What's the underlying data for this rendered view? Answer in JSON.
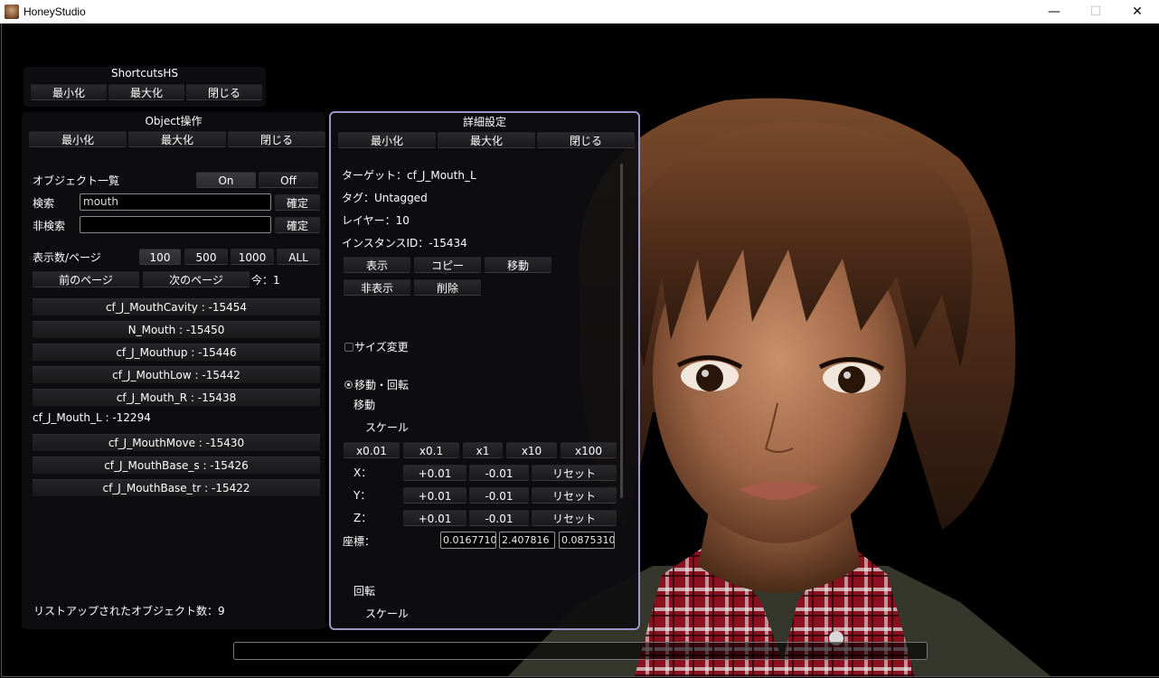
{
  "window": {
    "title": "HoneyStudio",
    "controls": {
      "minimize": "—",
      "maximize": "☐",
      "close": "✕"
    }
  },
  "shortcuts_panel": {
    "title": "ShortcutsHS",
    "buttons": [
      "最小化",
      "最大化",
      "閉じる"
    ]
  },
  "object_panel": {
    "title": "Object操作",
    "buttons": [
      "最小化",
      "最大化",
      "閉じる"
    ],
    "object_list_label": "オブジェクト一覧",
    "on_label": "On",
    "off_label": "Off",
    "search_label": "検索",
    "search_value": "mouth",
    "confirm_label": "確定",
    "exclude_label": "非検索",
    "exclude_value": "",
    "per_page_label": "表示数/ページ",
    "per_page_options": [
      "100",
      "500",
      "1000",
      "ALL"
    ],
    "prev_page": "前のページ",
    "next_page": "次のページ",
    "current_page": "今：1",
    "items": [
      "cf_J_MouthCavity : -15454",
      "N_Mouth : -15450",
      "cf_J_Mouthup : -15446",
      "cf_J_MouthLow : -15442",
      "cf_J_Mouth_R : -15438",
      "cf_J_Mouth_L : -12294",
      "cf_J_MouthMove : -15430",
      "cf_J_MouthBase_s : -15426",
      "cf_J_MouthBase_tr : -15422"
    ],
    "count_label": "リストアップされたオブジェクト数：9"
  },
  "detail_panel": {
    "title": "詳細設定",
    "buttons": [
      "最小化",
      "最大化",
      "閉じる"
    ],
    "target": "ターゲット：cf_J_Mouth_L",
    "tag": "タグ：Untagged",
    "layer": "レイヤー：10",
    "instance": "インスタンスID：-15434",
    "actions_row1": [
      "表示",
      "コピー",
      "移動"
    ],
    "actions_row2": [
      "非表示",
      "削除"
    ],
    "resize_label": "サイズ変更",
    "move_rotate_label": "移動・回転",
    "move_label": "移動",
    "scale_label": "スケール",
    "multipliers": [
      "x0.01",
      "x0.1",
      "x1",
      "x10",
      "x100"
    ],
    "axes": [
      {
        "label": "X：",
        "plus": "+0.01",
        "minus": "-0.01",
        "reset": "リセット"
      },
      {
        "label": "Y：",
        "plus": "+0.01",
        "minus": "-0.01",
        "reset": "リセット"
      },
      {
        "label": "Z：",
        "plus": "+0.01",
        "minus": "-0.01",
        "reset": "リセット"
      }
    ],
    "coord_label": "座標：",
    "coords": [
      "0.0167710",
      "2.407816",
      "0.0875310"
    ],
    "rotate_label": "回転",
    "scale_label2": "スケール"
  },
  "bottom_bar": {
    "value": ""
  }
}
